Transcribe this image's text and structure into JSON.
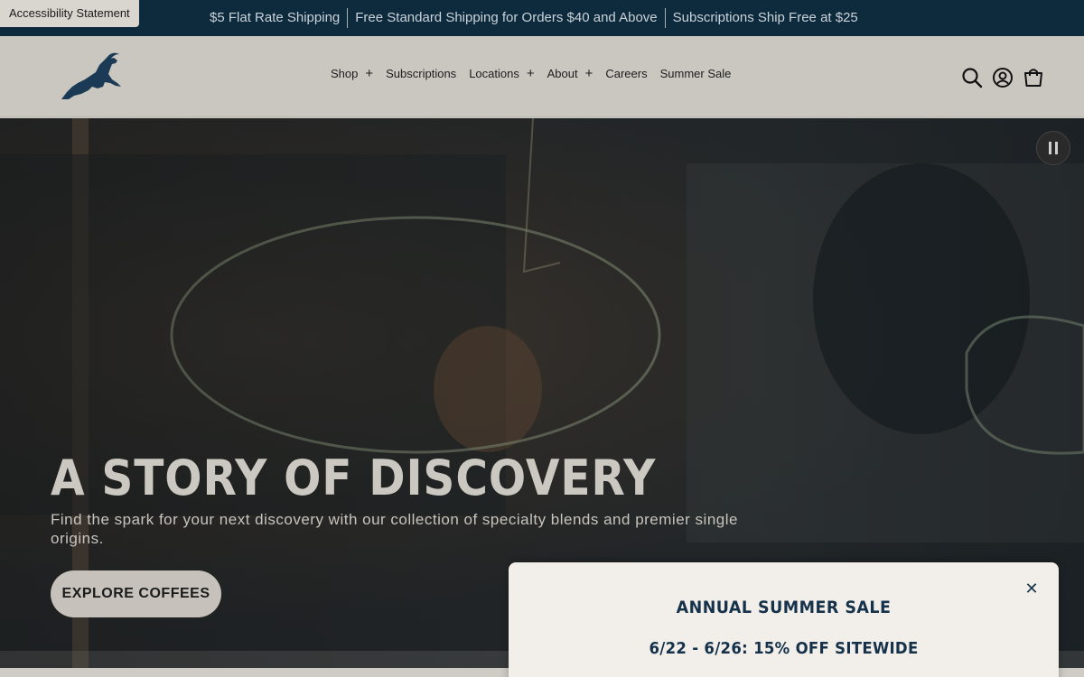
{
  "announcement": {
    "accessibility_label": "Accessibility Statement",
    "items": [
      "$5 Flat Rate Shipping",
      "Free Standard Shipping for Orders $40 and Above",
      "Subscriptions Ship Free at $25"
    ]
  },
  "header": {
    "logo_icon": "leaping-goat-logo",
    "nav": [
      {
        "label": "Shop",
        "has_submenu": true
      },
      {
        "label": "Subscriptions",
        "has_submenu": false
      },
      {
        "label": "Locations",
        "has_submenu": true
      },
      {
        "label": "About",
        "has_submenu": true
      },
      {
        "label": "Careers",
        "has_submenu": false
      },
      {
        "label": "Summer Sale",
        "has_submenu": false
      }
    ],
    "submenu_indicator": "+",
    "icons": [
      "search-icon",
      "account-icon",
      "cart-icon"
    ]
  },
  "hero": {
    "title": "A STORY OF DISCOVERY",
    "subtitle": "Find the spark for your next discovery with our collection of specialty blends and premier single origins.",
    "cta_label": "EXPLORE COFFEES",
    "pause_icon": "pause-icon"
  },
  "popup": {
    "title": "ANNUAL SUMMER SALE",
    "subtitle": "6/22 - 6/26: 15% OFF SITEWIDE",
    "close_glyph": "✕"
  },
  "colors": {
    "announcement_bg": "#0e2a3d",
    "header_bg": "#cac7c1",
    "brand_navy": "#15324a",
    "popup_bg": "#f2efea"
  }
}
